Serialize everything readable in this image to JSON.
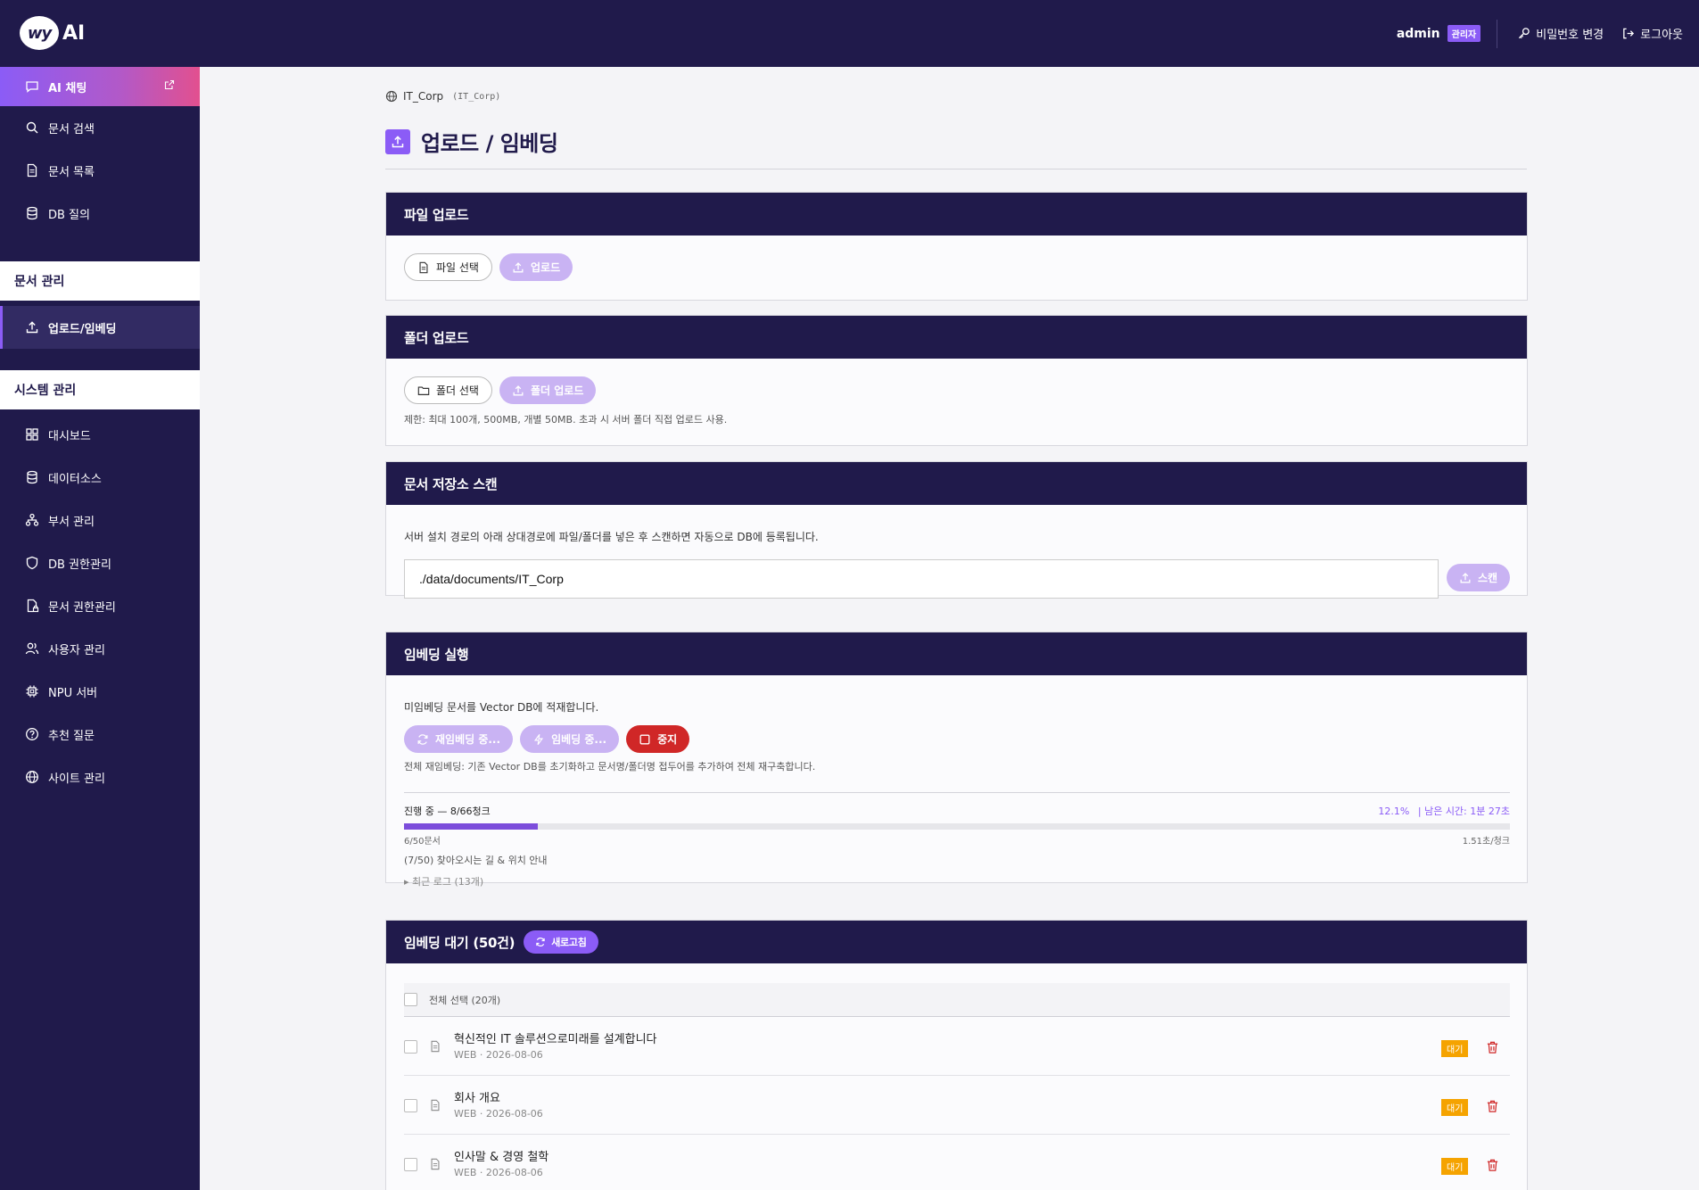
{
  "header": {
    "logo_mark": "wy",
    "logo_text": "AI",
    "user": "admin",
    "role": "관리자",
    "change_password": "비밀번호 변경",
    "logout": "로그아웃"
  },
  "sidebar": {
    "chat": "AI 채팅",
    "items": [
      "문서 검색",
      "문서 목록",
      "DB 질의"
    ],
    "doc_section": "문서 관리",
    "doc_items": [
      "업로드/임베딩"
    ],
    "sys_section": "시스템 관리",
    "sys_items": [
      "대시보드",
      "데이터소스",
      "부서 관리",
      "DB 권한관리",
      "문서 권한관리",
      "사용자 관리",
      "NPU 서버",
      "추천 질문",
      "사이트 관리"
    ]
  },
  "breadcrumb": {
    "site": "IT_Corp",
    "code": "(IT_Corp)"
  },
  "page_title": "업로드 / 임베딩",
  "file_upload": {
    "title": "파일 업로드",
    "select": "파일 선택",
    "upload": "업로드"
  },
  "folder_upload": {
    "title": "폴더 업로드",
    "select": "폴더 선택",
    "upload": "폴더 업로드",
    "hint": "제한: 최대 100개, 500MB, 개별 50MB. 초과 시 서버 폴더 직접 업로드 사용."
  },
  "scan": {
    "title": "문서 저장소 스캔",
    "desc": "서버 설치 경로의 아래 상대경로에 파일/폴더를 넣은 후 스캔하면 자동으로 DB에 등록됩니다.",
    "path": "./data/documents/IT_Corp",
    "button": "스캔"
  },
  "embedding": {
    "title": "임베딩 실행",
    "desc": "미임베딩 문서를 Vector DB에 적재합니다.",
    "reembed": "재임베딩 중...",
    "embed": "임베딩 중...",
    "stop": "중지",
    "hint": "전체 재임베딩: 기존 Vector DB를 초기화하고 문서명/폴더명 접두어를 추가하여 전체 재구축합니다.",
    "status": "진행 중 — 8/66청크",
    "percent_text": "12.1%",
    "remaining": "| 남은 시간: 1분 27초",
    "progress": 0.121,
    "docs": "6/50문서",
    "rate": "1.51초/청크",
    "current": "(7/50) 찾아오시는 길 & 위치 안내",
    "logs": "▸ 최근 로그 (13개)"
  },
  "queue": {
    "title": "임베딩 대기 (50건)",
    "refresh": "새로고침",
    "select_all": "전체 선택 (20개)",
    "items": [
      {
        "title": "혁신적인 IT 솔루션으로미래를 설계합니다",
        "meta": "WEB · 2026-08-06",
        "status": "대기"
      },
      {
        "title": "회사 개요",
        "meta": "WEB · 2026-08-06",
        "status": "대기"
      },
      {
        "title": "인사말 & 경영 철학",
        "meta": "WEB · 2026-08-06",
        "status": "대기"
      }
    ]
  },
  "colors": {
    "navy": "#201a4b",
    "accent": "#8b5cf6",
    "danger": "#d02727",
    "wait": "#f5a300"
  }
}
